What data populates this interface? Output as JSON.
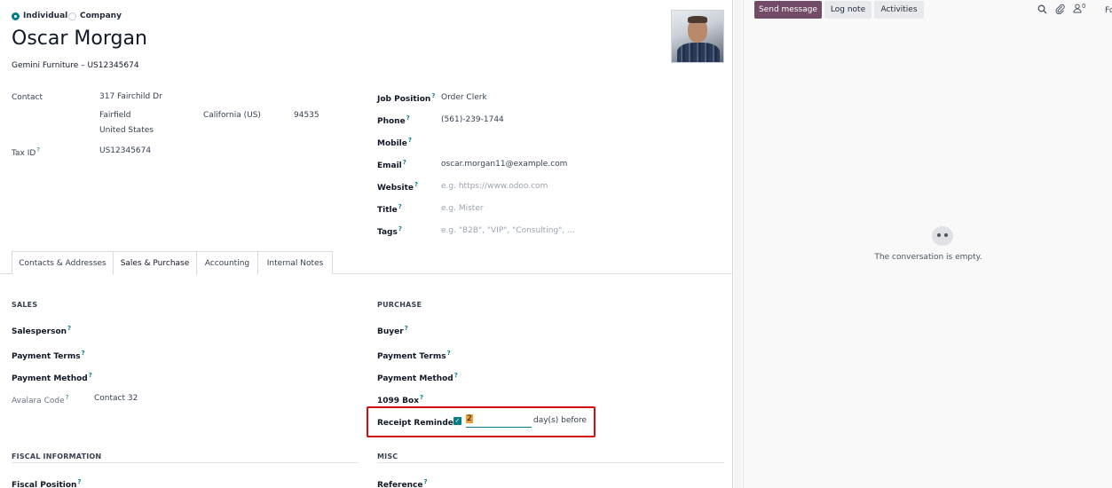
{
  "partner_type": {
    "individual": "Individual",
    "company": "Company",
    "selected": "individual"
  },
  "partner": {
    "name": "Oscar Morgan",
    "company_line": "Gemini Furniture – US12345674"
  },
  "left_fields": {
    "contact_label": "Contact",
    "street": "317 Fairchild Dr",
    "city": "Fairfield",
    "state": "California (US)",
    "zip": "94535",
    "country": "United States",
    "tax_id_label": "Tax ID",
    "tax_id": "US12345674"
  },
  "right_fields": {
    "job_position_label": "Job Position",
    "job_position": "Order Clerk",
    "phone_label": "Phone",
    "phone": "(561)-239-1744",
    "mobile_label": "Mobile",
    "email_label": "Email",
    "email": "oscar.morgan11@example.com",
    "website_label": "Website",
    "website_placeholder": "e.g. https://www.odoo.com",
    "title_label": "Title",
    "title_placeholder": "e.g. Mister",
    "tags_label": "Tags",
    "tags_placeholder": "e.g. \"B2B\", \"VIP\", \"Consulting\", ..."
  },
  "tabs": [
    {
      "label": "Contacts & Addresses"
    },
    {
      "label": "Sales & Purchase"
    },
    {
      "label": "Accounting"
    },
    {
      "label": "Internal Notes"
    }
  ],
  "sales": {
    "heading": "SALES",
    "salesperson": "Salesperson",
    "payment_terms": "Payment Terms",
    "payment_method": "Payment Method",
    "avalara_code_label": "Avalara Code",
    "avalara_code": "Contact 32"
  },
  "purchase": {
    "heading": "PURCHASE",
    "buyer": "Buyer",
    "payment_terms": "Payment Terms",
    "payment_method": "Payment Method",
    "box_1099": "1099 Box",
    "receipt_reminder_label": "Receipt Reminder",
    "receipt_reminder_value": "2",
    "receipt_reminder_suffix": "day(s) before"
  },
  "bottom": {
    "fiscal_heading": "FISCAL INFORMATION",
    "fiscal_position": "Fiscal Position",
    "misc_heading": "MISC",
    "reference": "Reference"
  },
  "help_mark": "?",
  "chatter": {
    "send_message": "Send message",
    "log_note": "Log note",
    "activities": "Activities",
    "followers_count": "0",
    "follow_partial": "Fo",
    "empty_text": "The conversation is empty."
  },
  "colors": {
    "accent": "#017e84",
    "primary_button": "#714b67",
    "highlight": "#d40d12"
  }
}
